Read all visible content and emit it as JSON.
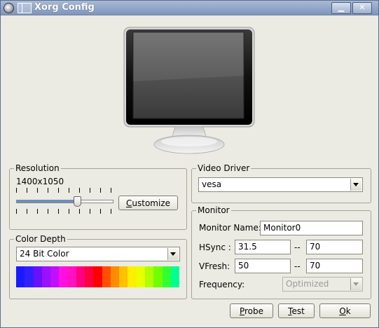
{
  "window": {
    "title": "Xorg Config"
  },
  "resolution": {
    "legend": "Resolution",
    "value": "1400x1050",
    "slider_position": 0.64,
    "customize_button": "Customize"
  },
  "color_depth": {
    "legend": "Color Depth",
    "selected": "24 Bit Color",
    "palette": [
      "#1a1aff",
      "#3020ff",
      "#6a10ff",
      "#9a10ff",
      "#c010ff",
      "#ff10e0",
      "#ff10c0",
      "#ff0080",
      "#ff0040",
      "#ff0000",
      "#ff5000",
      "#ff8c00",
      "#ffc000",
      "#ffee00",
      "#e8ff00",
      "#b0ff00",
      "#70ff00",
      "#30ff30",
      "#00ff90"
    ]
  },
  "video_driver": {
    "legend": "Video Driver",
    "selected": "vesa"
  },
  "monitor": {
    "legend": "Monitor",
    "name_label": "Monitor Name:",
    "name_value": "Monitor0",
    "hsync_label": "HSync :",
    "hsync_min": "31.5",
    "hsync_max": "70",
    "vfresh_label": "VFresh:",
    "vfresh_min": "50",
    "vfresh_max": "70",
    "range_separator": "--",
    "frequency_label": "Frequency:",
    "frequency_value": "Optimized"
  },
  "buttons": {
    "probe": "Probe",
    "test": "Test",
    "ok": "Ok"
  },
  "colors": {
    "titlebar": "#7f95bd",
    "window_bg": "#ecebe3"
  }
}
